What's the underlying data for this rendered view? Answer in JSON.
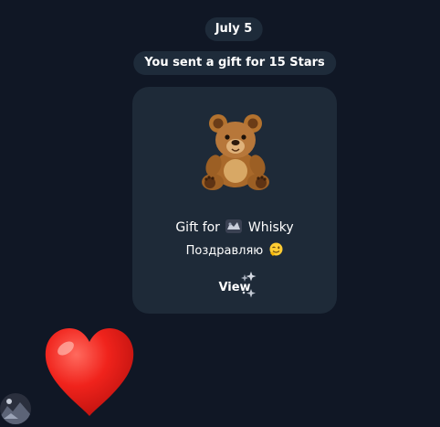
{
  "date_label": "July 5",
  "service_message": "You sent a gift for 15 Stars",
  "gift": {
    "sticker": "teddy-bear",
    "title_prefix": "Gift for",
    "recipient_name": "Whisky",
    "message": "Поздравляю",
    "message_emoji": "winking-face",
    "view_label": "View"
  },
  "reaction_sticker": "red-heart",
  "colors": {
    "background": "#101725",
    "bubble": "#1e2a38",
    "pill": "#1e2b3a",
    "text": "#ffffff"
  }
}
